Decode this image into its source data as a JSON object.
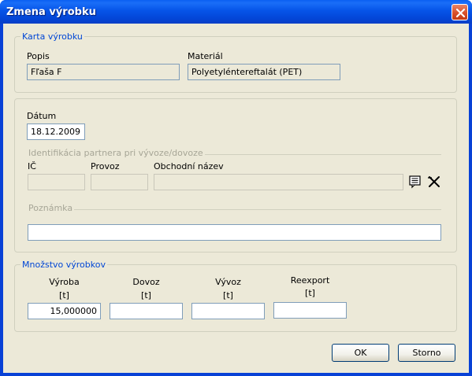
{
  "window": {
    "title": "Zmena výrobku"
  },
  "karta": {
    "legend": "Karta výrobku",
    "popis_label": "Popis",
    "popis_value": "Fľaša F",
    "material_label": "Materiál",
    "material_value": "Polyetyléntereftalát (PET)"
  },
  "datum": {
    "label": "Dátum",
    "value": "18.12.2009"
  },
  "partner": {
    "legend": "Identifikácia partnera pri vývoze/dovoze",
    "ic_label": "IČ",
    "provoz_label": "Provoz",
    "nazov_label": "Obchodní název",
    "ic_value": "",
    "provoz_value": "",
    "nazov_value": ""
  },
  "poznamka": {
    "legend": "Poznámka",
    "value": ""
  },
  "mnozstvo": {
    "legend": "Množstvo výrobkov",
    "columns": [
      {
        "name": "Výroba",
        "unit": "[t]",
        "value": "15,000000"
      },
      {
        "name": "Dovoz",
        "unit": "[t]",
        "value": ""
      },
      {
        "name": "Vývoz",
        "unit": "[t]",
        "value": ""
      },
      {
        "name": "Reexport",
        "unit": "[t]",
        "value": ""
      }
    ]
  },
  "buttons": {
    "ok": "OK",
    "storno": "Storno"
  },
  "icons": {
    "close": "close-icon",
    "select": "list-select-icon",
    "clear": "clear-x-icon"
  }
}
